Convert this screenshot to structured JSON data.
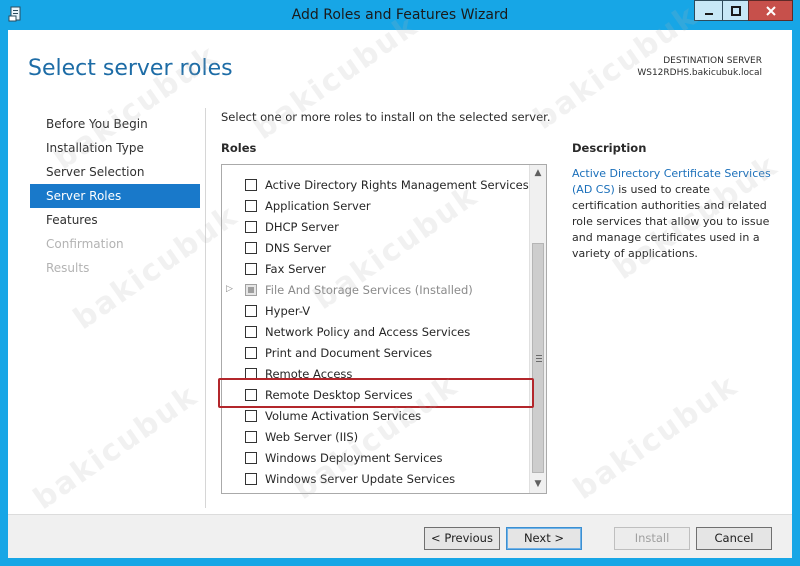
{
  "window": {
    "title": "Add Roles and Features Wizard",
    "accent_color": "#17a6e6",
    "icons": [
      "server-manager-icon",
      "minimize-icon",
      "maximize-icon",
      "close-icon"
    ]
  },
  "page": {
    "title": "Select server roles",
    "destination_label": "DESTINATION SERVER",
    "destination_value": "WS12RDHS.bakicubuk.local"
  },
  "nav": {
    "items": [
      {
        "label": "Before You Begin",
        "state": "normal"
      },
      {
        "label": "Installation Type",
        "state": "normal"
      },
      {
        "label": "Server Selection",
        "state": "normal"
      },
      {
        "label": "Server Roles",
        "state": "active"
      },
      {
        "label": "Features",
        "state": "normal"
      },
      {
        "label": "Confirmation",
        "state": "disabled"
      },
      {
        "label": "Results",
        "state": "disabled"
      }
    ]
  },
  "main": {
    "instruction": "Select one or more roles to install on the selected server.",
    "roles_label": "Roles",
    "roles": [
      {
        "label": "Active Directory Rights Management Services",
        "checked": false
      },
      {
        "label": "Application Server",
        "checked": false
      },
      {
        "label": "DHCP Server",
        "checked": false
      },
      {
        "label": "DNS Server",
        "checked": false
      },
      {
        "label": "Fax Server",
        "checked": false
      },
      {
        "label": "File And Storage Services (Installed)",
        "checked": false,
        "disabled": true,
        "expandable": true
      },
      {
        "label": "Hyper-V",
        "checked": false
      },
      {
        "label": "Network Policy and Access Services",
        "checked": false
      },
      {
        "label": "Print and Document Services",
        "checked": false
      },
      {
        "label": "Remote Access",
        "checked": false
      },
      {
        "label": "Remote Desktop Services",
        "checked": false,
        "highlighted": true
      },
      {
        "label": "Volume Activation Services",
        "checked": false
      },
      {
        "label": "Web Server (IIS)",
        "checked": false
      },
      {
        "label": "Windows Deployment Services",
        "checked": false
      },
      {
        "label": "Windows Server Update Services",
        "checked": false
      }
    ]
  },
  "description": {
    "title": "Description",
    "link_text": "Active Directory Certificate Services (AD CS)",
    "body": " is used to create certification authorities and related role services that allow you to issue and manage certificates used in a variety of applications."
  },
  "footer": {
    "previous_label": "< Previous",
    "next_label": "Next >",
    "install_label": "Install",
    "cancel_label": "Cancel"
  },
  "watermark_text": "bakicubuk"
}
